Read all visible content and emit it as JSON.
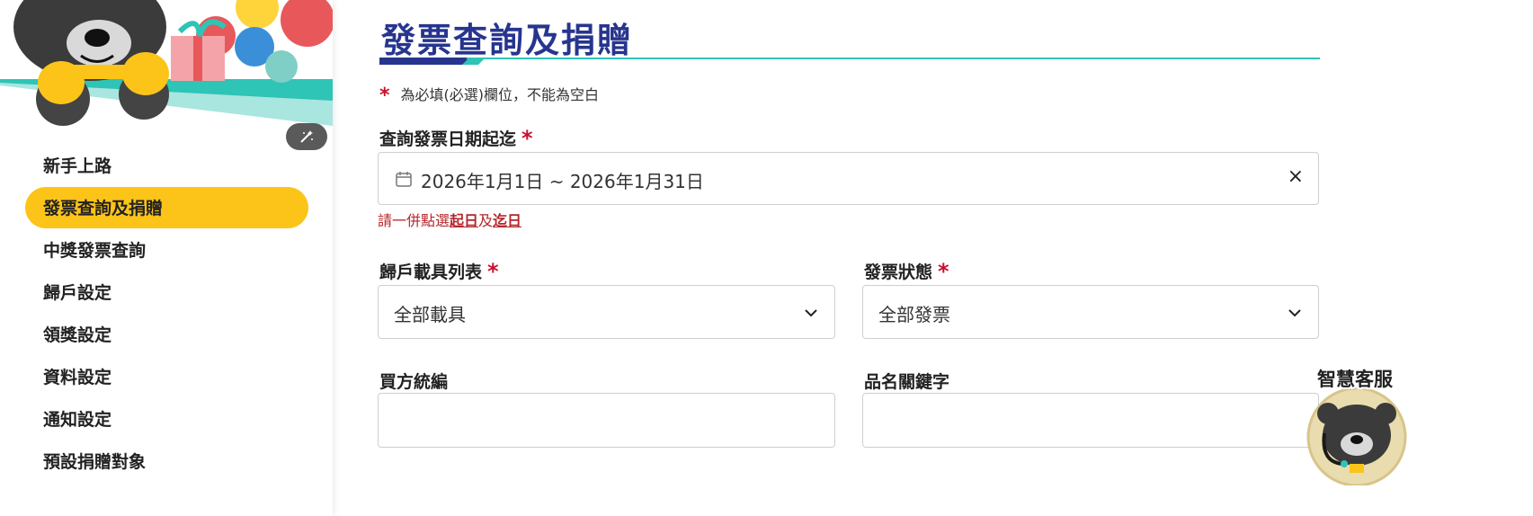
{
  "sidebar": {
    "edit_icon": "magic-wand-icon",
    "items": [
      {
        "label": "新手上路",
        "active": false
      },
      {
        "label": "發票查詢及捐贈",
        "active": true
      },
      {
        "label": "中獎發票查詢",
        "active": false
      },
      {
        "label": "歸戶設定",
        "active": false
      },
      {
        "label": "領獎設定",
        "active": false
      },
      {
        "label": "資料設定",
        "active": false
      },
      {
        "label": "通知設定",
        "active": false
      },
      {
        "label": "預設捐贈對象",
        "active": false
      }
    ]
  },
  "main": {
    "title": "發票查詢及捐贈",
    "required_note": "為必填(必選)欄位，不能為空白",
    "date_range": {
      "label": "查詢發票日期起迄",
      "value": "2026年1月1日 ~ 2026年1月31日",
      "hint_prefix": "請一併點選",
      "hint_start": "起日",
      "hint_and": "及",
      "hint_end": "迄日"
    },
    "carrier": {
      "label": "歸戶載具列表",
      "value": "全部載具"
    },
    "status": {
      "label": "發票狀態",
      "value": "全部發票"
    },
    "buyer_id": {
      "label": "買方統編",
      "value": ""
    },
    "keyword": {
      "label": "品名關鍵字",
      "value": ""
    }
  },
  "chatbot": {
    "label": "智慧客服"
  },
  "colors": {
    "accent_yellow": "#fcc419",
    "title_blue": "#27358f",
    "required_red": "#c8102e",
    "teal": "#2ec4b6"
  }
}
